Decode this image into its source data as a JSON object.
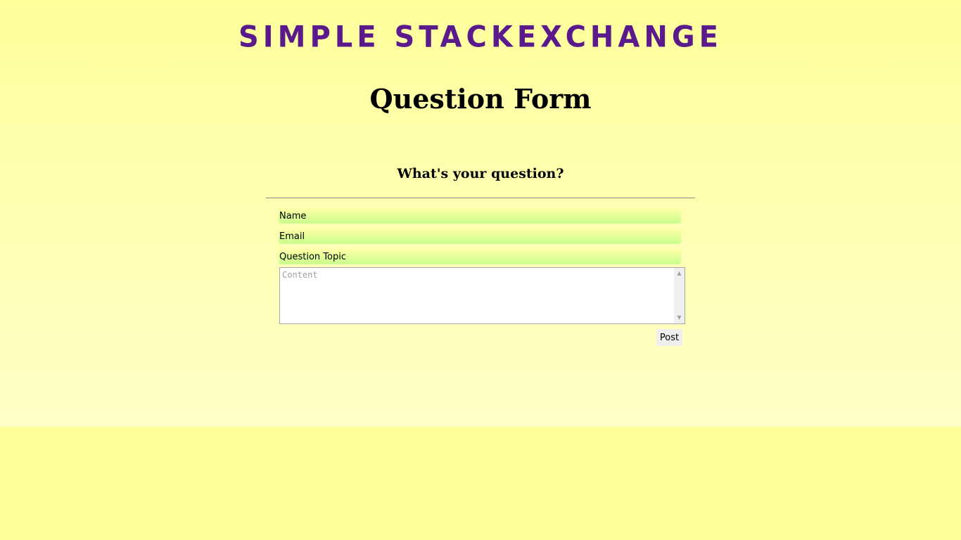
{
  "site": {
    "title": "Simple Stackexchange",
    "title_color": "#5b1a8c"
  },
  "page": {
    "heading": "Question Form"
  },
  "form": {
    "prompt": "What's your question?",
    "fields": {
      "name_placeholder": "Name",
      "email_placeholder": "Email",
      "topic_placeholder": "Question Topic",
      "content_placeholder": "Content"
    },
    "post_label": "Post"
  },
  "icons": {
    "scroll_up": "▲",
    "scroll_down": "▼"
  },
  "colors": {
    "background": "#ffff9c",
    "field_gradient_end": "#c8ff8c"
  }
}
